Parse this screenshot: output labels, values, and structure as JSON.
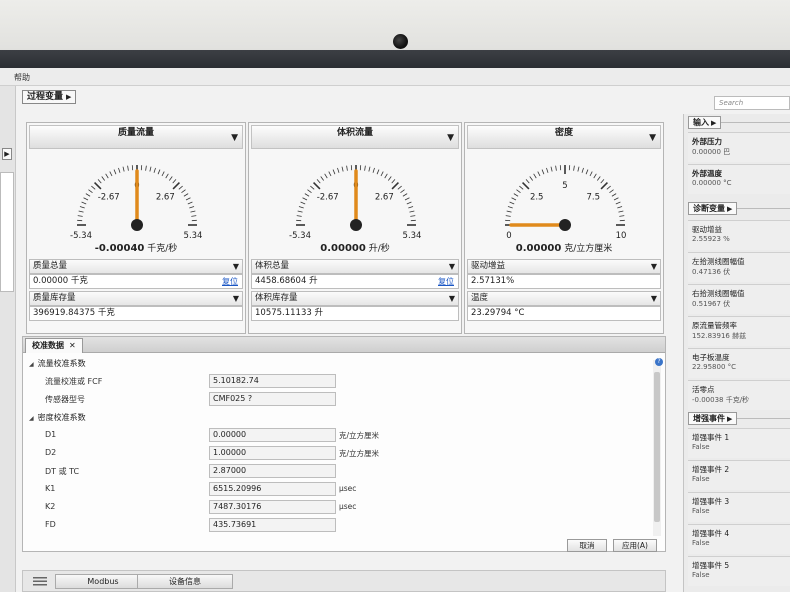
{
  "menu": {
    "help": "帮助"
  },
  "header": {
    "process_title": "过程变量",
    "search_placeholder": "Search"
  },
  "gauges": [
    {
      "title": "质量流量",
      "ticks": [
        "-2.67",
        "0",
        "2.67",
        "-5.34",
        "5.34"
      ],
      "value": "-0.00040",
      "unit": "千克/秒",
      "needle_fraction": 0.5,
      "row1_label": "质量总量",
      "row1_value": "0.00000 千克",
      "reset": "复位",
      "row2_label": "质量库存量",
      "row2_value": "396919.84375 千克"
    },
    {
      "title": "体积流量",
      "ticks": [
        "-2.67",
        "0",
        "2.67",
        "-5.34",
        "5.34"
      ],
      "value": "0.00000",
      "unit": "升/秒",
      "needle_fraction": 0.5,
      "row1_label": "体积总量",
      "row1_value": "4458.68604 升",
      "reset": "复位",
      "row2_label": "体积库存量",
      "row2_value": "10575.11133 升"
    },
    {
      "title": "密度",
      "ticks": [
        "2.5",
        "5",
        "7.5",
        "0",
        "10"
      ],
      "value": "0.00000",
      "unit": "克/立方厘米",
      "needle_fraction": 0.0,
      "row1_label": "驱动增益",
      "row1_value": "2.57131%",
      "row2_label": "温度",
      "row2_value": "23.29794 °C"
    }
  ],
  "right_panel": {
    "inputs_title": "输入",
    "inputs": [
      {
        "label": "外部压力",
        "value": "0.00000  巴"
      },
      {
        "label": "外部温度",
        "value": "0.00000  °C"
      }
    ],
    "diag_title": "诊断变量",
    "diagnostics": [
      {
        "label": "驱动增益",
        "value": "2.55923  %"
      },
      {
        "label": "左拾测线圈幅值",
        "value": "0.47136  伏"
      },
      {
        "label": "右拾测线圈幅值",
        "value": "0.51967  伏"
      },
      {
        "label": "原流量管频率",
        "value": "152.83916  赫兹"
      },
      {
        "label": "电子板温度",
        "value": "22.95800  °C"
      },
      {
        "label": "活零点",
        "value": "-0.00038  千克/秒"
      }
    ],
    "events_title": "增强事件",
    "events": [
      {
        "label": "增强事件 1",
        "value": "False"
      },
      {
        "label": "增强事件 2",
        "value": "False"
      },
      {
        "label": "增强事件 3",
        "value": "False"
      },
      {
        "label": "增强事件 4",
        "value": "False"
      },
      {
        "label": "增强事件 5",
        "value": "False"
      }
    ]
  },
  "calibration": {
    "tab": "校准数据",
    "flow_group": "流量校准系数",
    "flow_rows": [
      {
        "label": "流量校准或 FCF",
        "value": "5.10182.74",
        "unit": ""
      },
      {
        "label": "传感器型号",
        "value": "CMF025 ?",
        "unit": ""
      }
    ],
    "density_group": "密度校准系数",
    "density_rows": [
      {
        "label": "D1",
        "value": "0.00000",
        "unit": "克/立方厘米"
      },
      {
        "label": "D2",
        "value": "1.00000",
        "unit": "克/立方厘米"
      },
      {
        "label": "DT 或 TC",
        "value": "2.87000",
        "unit": ""
      },
      {
        "label": "K1",
        "value": "6515.20996",
        "unit": "μsec"
      },
      {
        "label": "K2",
        "value": "7487.30176",
        "unit": "μsec"
      },
      {
        "label": "FD",
        "value": "435.73691",
        "unit": ""
      }
    ],
    "cancel": "取消",
    "apply": "应用(A)"
  },
  "bottom": {
    "modbus": "Modbus",
    "device_info": "设备信息"
  },
  "colors": {
    "needle": "#e08a1c",
    "accent_link": "#1a56c4"
  }
}
